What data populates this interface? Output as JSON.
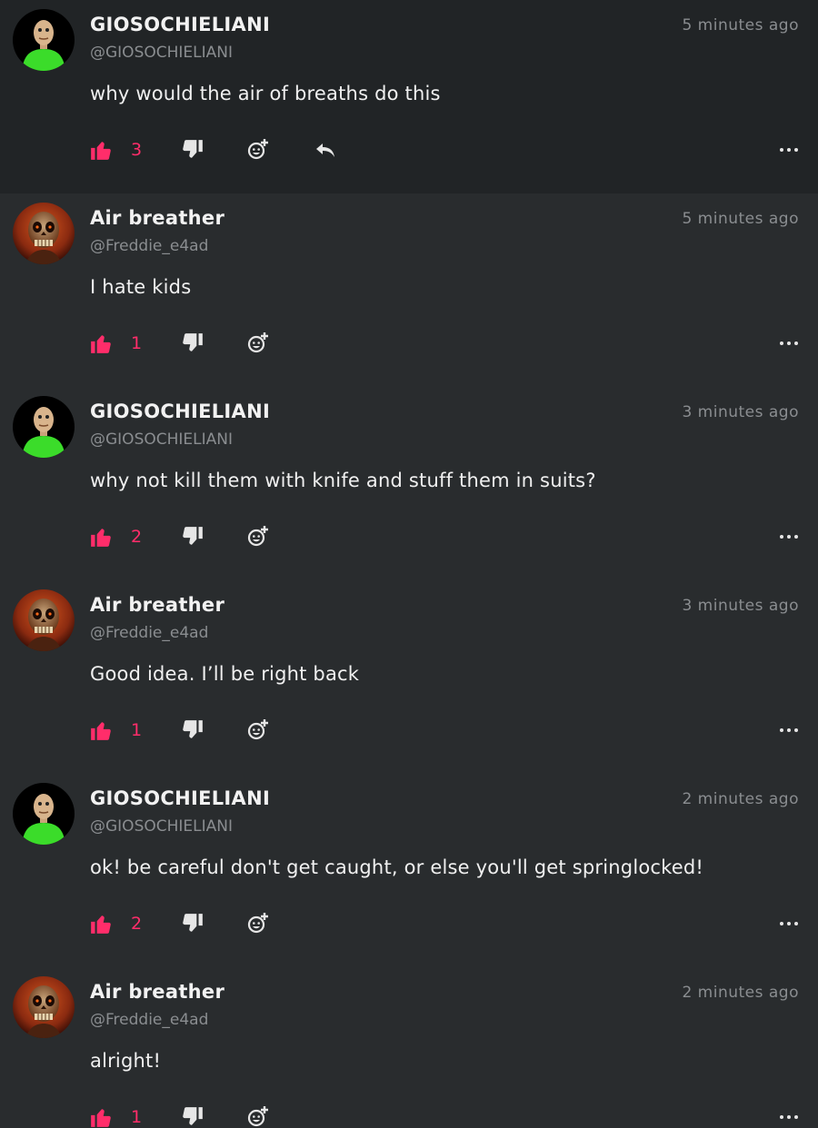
{
  "comments": [
    {
      "author": "GIOSOCHIELIANI",
      "handle": "@GIOSOCHIELIANI",
      "time": "5 minutes ago",
      "text": "why would the air of breaths do this",
      "likes": "3",
      "avatar": "green-character-avatar",
      "has_reply": true
    },
    {
      "author": "Air breather",
      "handle": "@Freddie_e4ad",
      "time": "5 minutes ago",
      "text": "I hate kids",
      "likes": "1",
      "avatar": "skull-avatar",
      "has_reply": false
    },
    {
      "author": "GIOSOCHIELIANI",
      "handle": "@GIOSOCHIELIANI",
      "time": "3 minutes ago",
      "text": "why not kill them with knife and stuff them in suits?",
      "likes": "2",
      "avatar": "green-character-avatar",
      "has_reply": false
    },
    {
      "author": "Air breather",
      "handle": "@Freddie_e4ad",
      "time": "3 minutes ago",
      "text": "Good idea. I’ll be right back",
      "likes": "1",
      "avatar": "skull-avatar",
      "has_reply": false
    },
    {
      "author": "GIOSOCHIELIANI",
      "handle": "@GIOSOCHIELIANI",
      "time": "2 minutes ago",
      "text": "ok! be careful don't get caught, or else you'll get springlocked!",
      "likes": "2",
      "avatar": "green-character-avatar",
      "has_reply": false
    },
    {
      "author": "Air breather",
      "handle": "@Freddie_e4ad",
      "time": "2 minutes ago",
      "text": "alright!",
      "likes": "1",
      "avatar": "skull-avatar",
      "has_reply": false
    }
  ],
  "colors": {
    "accent": "#ff2d6a",
    "background": "#292c2e",
    "highlight_background": "#212426",
    "muted_text": "#8a8d90"
  }
}
